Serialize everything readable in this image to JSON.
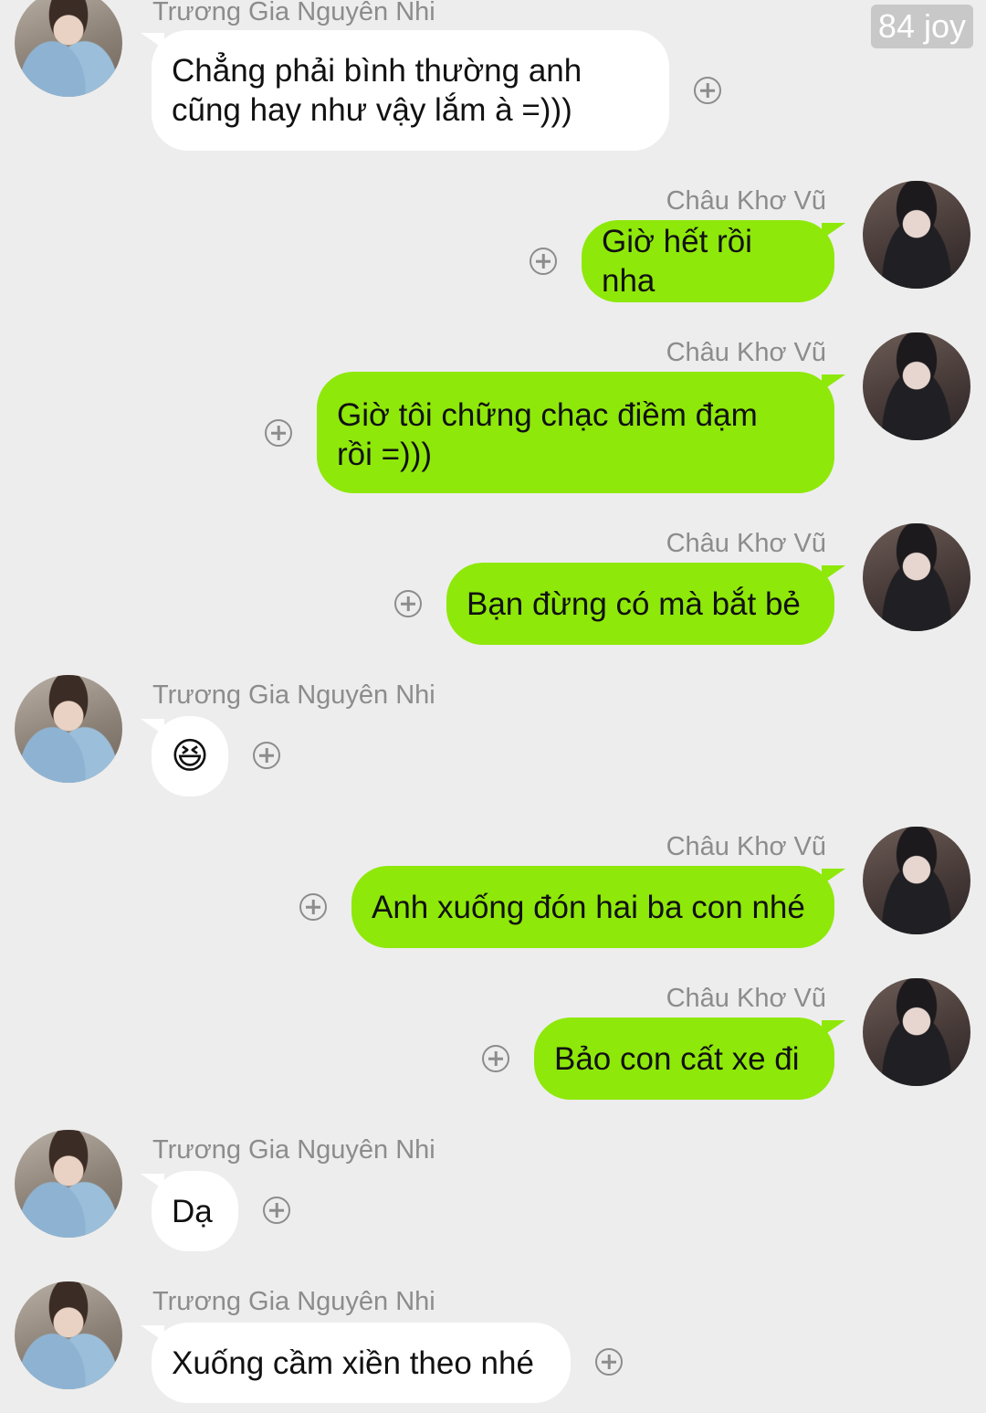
{
  "watermark": "84 joy",
  "messages": [
    {
      "side": "left",
      "sender": "Trương Gia Nguyên Nhi",
      "lines": [
        "Chẳng phải bình thường anh",
        "cũng hay như vậy lắm à =)))"
      ]
    },
    {
      "side": "right",
      "sender": "Châu Khơ Vũ",
      "lines": [
        "Giờ hết rồi nha"
      ]
    },
    {
      "side": "right",
      "sender": "Châu Khơ Vũ",
      "lines": [
        "Giờ tôi chững chạc điềm đạm",
        "rồi =)))"
      ]
    },
    {
      "side": "right",
      "sender": "Châu Khơ Vũ",
      "lines": [
        "Bạn đừng có mà bắt bẻ"
      ]
    },
    {
      "side": "left",
      "sender": "Trương Gia Nguyên Nhi",
      "emoji": "😆"
    },
    {
      "side": "right",
      "sender": "Châu Khơ Vũ",
      "lines": [
        "Anh xuống đón hai ba con nhé"
      ]
    },
    {
      "side": "right",
      "sender": "Châu Khơ Vũ",
      "lines": [
        "Bảo con cất xe đi"
      ]
    },
    {
      "side": "left",
      "sender": "Trương Gia Nguyên Nhi",
      "lines": [
        "Dạ"
      ]
    },
    {
      "side": "left",
      "sender": "Trương Gia Nguyên Nhi",
      "lines": [
        "Xuống cầm xiền theo nhé"
      ]
    }
  ],
  "colors": {
    "background": "#ededed",
    "outgoing_bubble": "#8ee80a",
    "incoming_bubble": "#ffffff",
    "meta_text": "#8c8c8c"
  }
}
